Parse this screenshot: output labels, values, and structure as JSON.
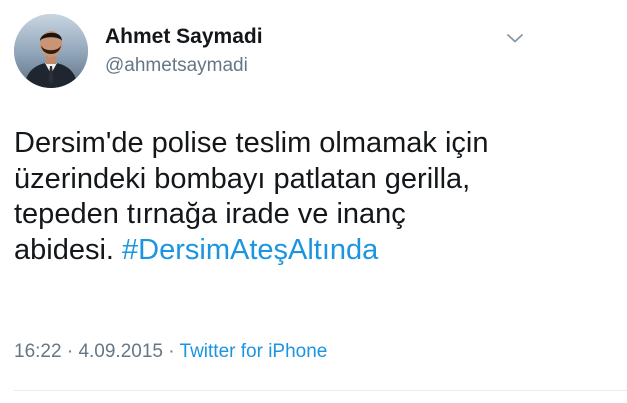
{
  "user": {
    "display_name": "Ahmet Saymadi",
    "handle": "@ahmetsaymadi",
    "avatar_icon": "profile-photo"
  },
  "menu": {
    "icon": "chevron-down-icon"
  },
  "tweet": {
    "lines": [
      "Dersim'de polise teslim olmamak için",
      "üzerindeki bombayı patlatan gerilla,",
      "tepeden tırnağa irade ve inanç",
      "abidesi."
    ],
    "hashtag": "#DersimAteşAltında"
  },
  "meta": {
    "time": "16:22",
    "separator": "·",
    "date": "4.09.2015",
    "source": "Twitter for iPhone"
  },
  "colors": {
    "text": "#14171a",
    "secondary": "#657786",
    "link": "#1b95e0",
    "divider": "#e6ecf0"
  }
}
